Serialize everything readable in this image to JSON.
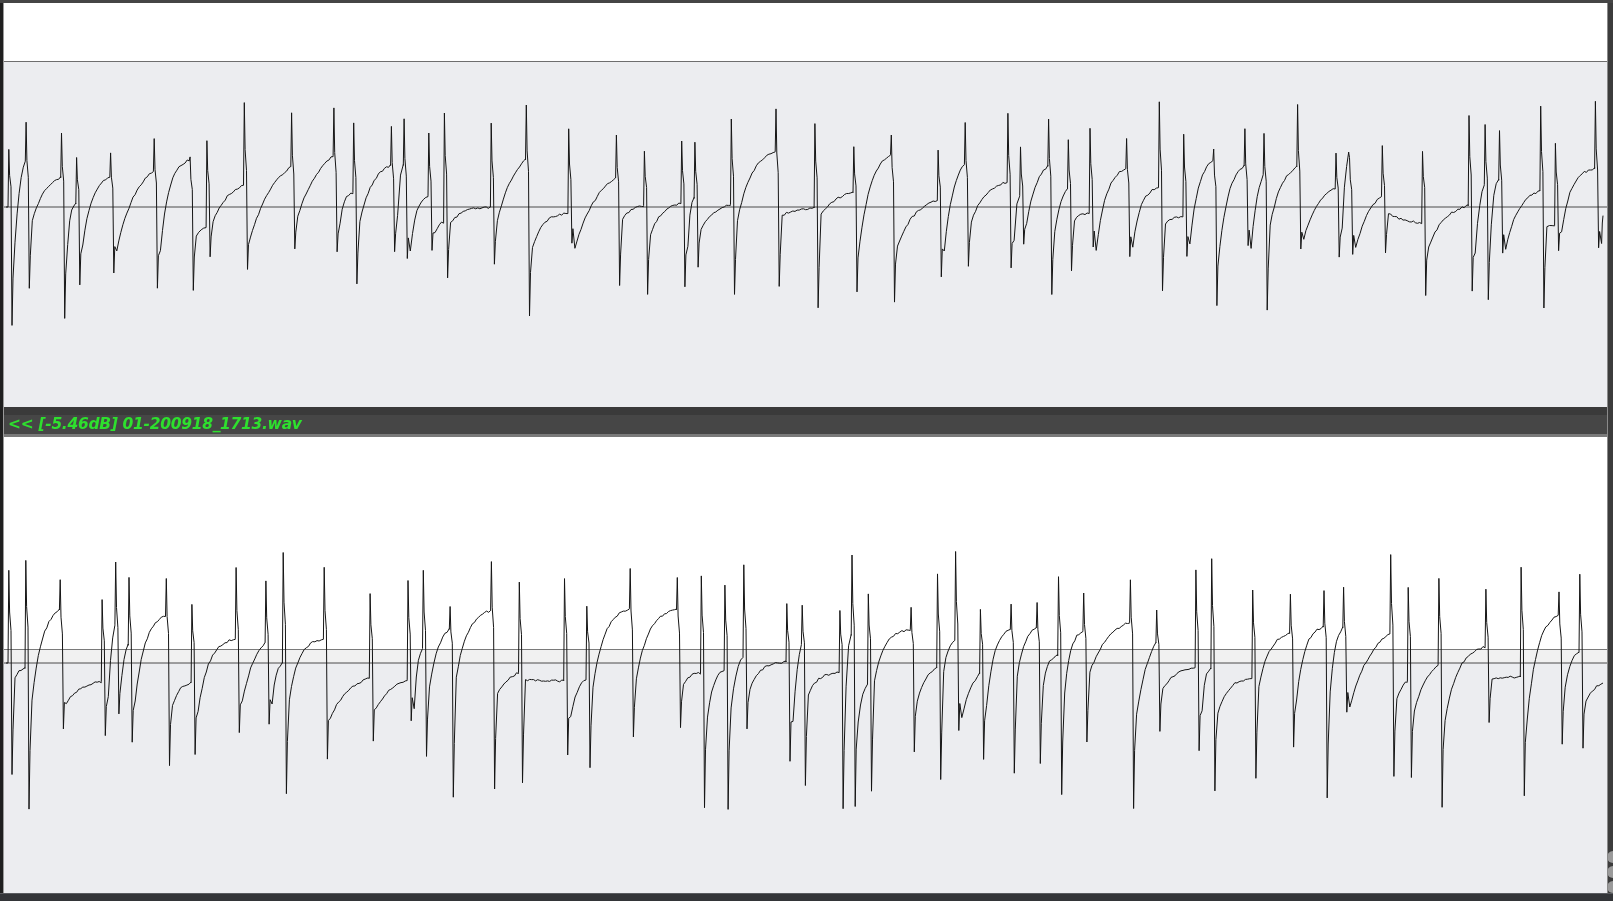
{
  "track_header": {
    "label": "<< [-5.46dB] 01-200918_1713.wav"
  }
}
